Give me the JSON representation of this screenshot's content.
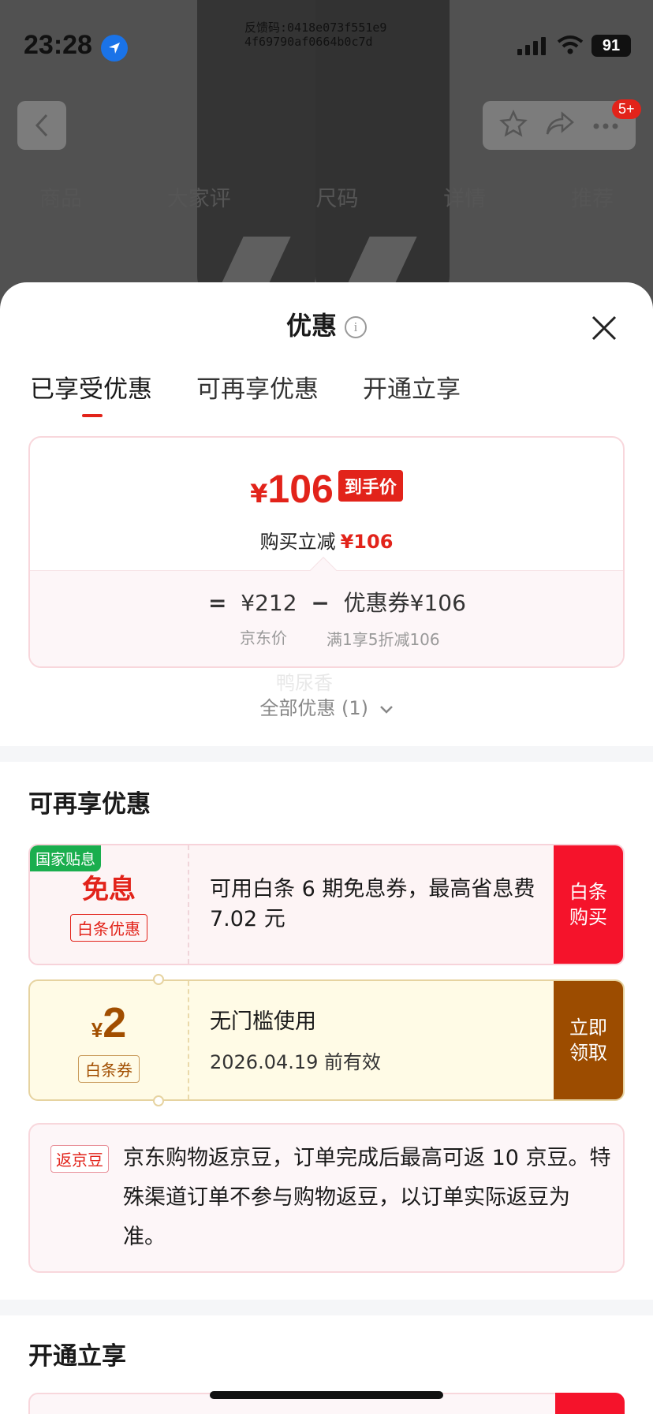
{
  "status_bar": {
    "time": "23:28",
    "feedback_code_line1": "反馈码:0418e073f551e9",
    "feedback_code_line2": "4f69790af0664b0c7d",
    "battery": "91"
  },
  "product_nav": {
    "badge": "5+",
    "tabs": [
      "商品",
      "大家评",
      "尺码",
      "详情",
      "推荐"
    ]
  },
  "sheet": {
    "title": "优惠",
    "tabs": [
      "已享受优惠",
      "可再享优惠",
      "开通立享"
    ],
    "price_card": {
      "currency": "¥",
      "final_price": "106",
      "final_tag": "到手价",
      "reduce_label": "购买立减",
      "reduce_value": "¥106",
      "equals": "=",
      "jd_price": "¥212",
      "minus": "−",
      "coupon_label": "优惠券",
      "coupon_value": "¥106",
      "jd_price_caption": "京东价",
      "coupon_caption": "满1享5折减106"
    },
    "watermark": "鸭尿香",
    "all_offers": "全部优惠 (1)",
    "section_more": {
      "title": "可再享优惠",
      "coupon1": {
        "tag": "国家贴息",
        "main": "免息",
        "sub": "白条优惠",
        "desc": "可用白条 6 期免息券，最高省息费 7.02 元",
        "action": "白条购买"
      },
      "coupon2": {
        "currency": "¥",
        "amount": "2",
        "sub": "白条券",
        "desc": "无门槛使用",
        "valid": "2026.04.19 前有效",
        "action": "立即领取"
      },
      "bean": {
        "tag": "返京豆",
        "text": "京东购物返京豆，订单完成后最高可返 10 京豆。特殊渠道订单不参与购物返豆，以订单实际返豆为准。"
      }
    },
    "section_open": {
      "title": "开通立享"
    }
  },
  "colors": {
    "accent_red": "#e2231a",
    "brown": "#9c4c00",
    "green_tag": "#1aae4e"
  }
}
